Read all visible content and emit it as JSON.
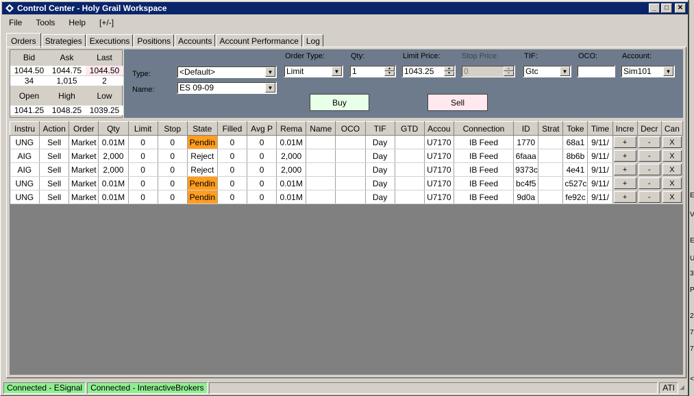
{
  "window": {
    "title": "Control Center - Holy Grail Workspace"
  },
  "menu": [
    "File",
    "Tools",
    "Help",
    "[+/-]"
  ],
  "tabs": [
    "Orders",
    "Strategies",
    "Executions",
    "Positions",
    "Accounts",
    "Account Performance",
    "Log"
  ],
  "quote": {
    "headers1": [
      "Bid",
      "Ask",
      "Last"
    ],
    "prices": [
      "1044.50",
      "1044.75",
      "1044.50"
    ],
    "sizes": [
      "34",
      "1,015",
      "2"
    ],
    "headers2": [
      "Open",
      "High",
      "Low"
    ],
    "ohl": [
      "1041.25",
      "1048.25",
      "1039.25"
    ]
  },
  "entry": {
    "type_label": "Type:",
    "type_value": "<Default>",
    "name_label": "Name:",
    "name_value": "ES 09-09",
    "order_type_label": "Order Type:",
    "order_type_value": "Limit",
    "qty_label": "Qty:",
    "qty_value": "1",
    "limit_price_label": "Limit Price:",
    "limit_price_value": "1043.25",
    "stop_price_label": "Stop Price:",
    "stop_price_value": "0",
    "tif_label": "TIF:",
    "tif_value": "Gtc",
    "oco_label": "OCO:",
    "oco_value": "",
    "account_label": "Account:",
    "account_value": "Sim101",
    "buy_label": "Buy",
    "sell_label": "Sell"
  },
  "grid": {
    "columns": [
      "Instru",
      "Action",
      "Order",
      "Qty",
      "Limit",
      "Stop",
      "State",
      "Filled",
      "Avg P",
      "Rema",
      "Name",
      "OCO",
      "TIF",
      "GTD",
      "Accou",
      "Connection",
      "ID",
      "Strat",
      "Toke",
      "Time",
      "Incre",
      "Decr",
      "Can"
    ],
    "rows": [
      [
        "UNG",
        "Sell",
        "Market",
        "0.01M",
        "0",
        "0",
        "Pendin",
        "0",
        "0",
        "0.01M",
        "",
        "",
        "Day",
        "",
        "U7170",
        "IB Feed",
        "1770",
        "",
        "68a1",
        "9/11/",
        "+",
        "-",
        "X"
      ],
      [
        "AIG",
        "Sell",
        "Market",
        "2,000",
        "0",
        "0",
        "Reject",
        "0",
        "0",
        "2,000",
        "",
        "",
        "Day",
        "",
        "U7170",
        "IB Feed",
        "6faaa",
        "",
        "8b6b",
        "9/11/",
        "+",
        "-",
        "X"
      ],
      [
        "AIG",
        "Sell",
        "Market",
        "2,000",
        "0",
        "0",
        "Reject",
        "0",
        "0",
        "2,000",
        "",
        "",
        "Day",
        "",
        "U7170",
        "IB Feed",
        "9373c",
        "",
        "4e41",
        "9/11/",
        "+",
        "-",
        "X"
      ],
      [
        "UNG",
        "Sell",
        "Market",
        "0.01M",
        "0",
        "0",
        "Pendin",
        "0",
        "0",
        "0.01M",
        "",
        "",
        "Day",
        "",
        "U7170",
        "IB Feed",
        "bc4f5",
        "",
        "c527c",
        "9/11/",
        "+",
        "-",
        "X"
      ],
      [
        "UNG",
        "Sell",
        "Market",
        "0.01M",
        "0",
        "0",
        "Pendin",
        "0",
        "0",
        "0.01M",
        "",
        "",
        "Day",
        "",
        "U7170",
        "IB Feed",
        "9d0a",
        "",
        "fe92c",
        "9/11/",
        "+",
        "-",
        "X"
      ]
    ]
  },
  "status": {
    "esignal": "Connected - ESignal",
    "ib": "Connected - InteractiveBrokers",
    "ati": "ATI"
  },
  "right_strip": [
    "E",
    "V",
    "E",
    "U",
    "3",
    "P",
    "2",
    "7",
    "7",
    "<"
  ],
  "colors": {
    "titlebar": "#0a246a",
    "entry_panel": "#6e7b8c",
    "pending": "#ff9e20",
    "buy_button": "#e8ffe8",
    "sell_button": "#ffe8ee",
    "connected": "#90ee90"
  }
}
